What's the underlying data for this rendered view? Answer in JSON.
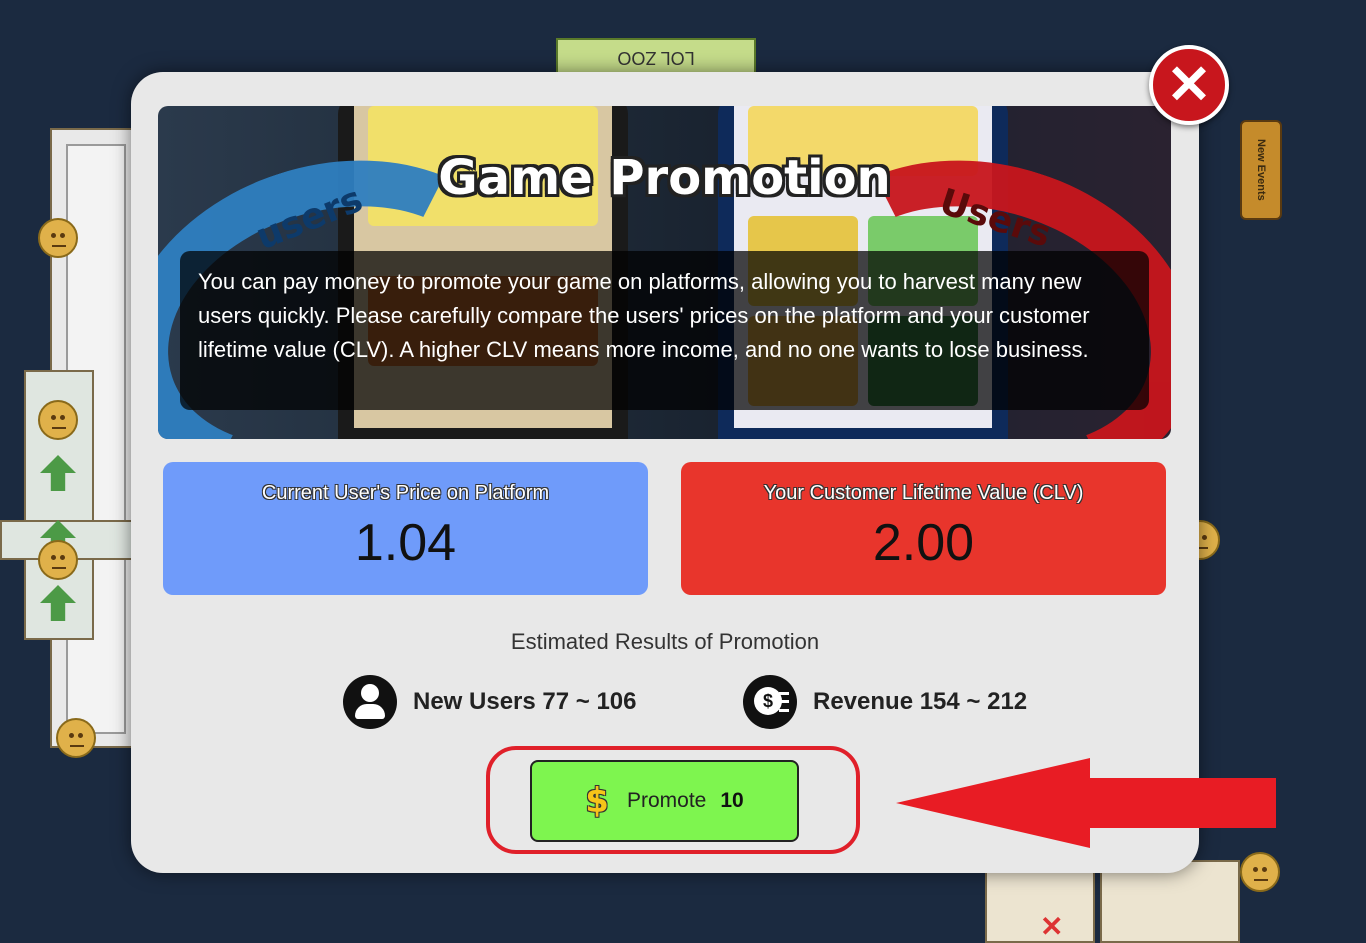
{
  "background": {
    "sign_text": "New Events",
    "top_sign_text": "LOL ZOO"
  },
  "modal": {
    "close_label": "✕",
    "banner": {
      "title": "Game Promotion",
      "swoosh_left": "users",
      "swoosh_right": "Users",
      "description": "You can pay money to promote your game on platforms, allowing you to harvest many new users quickly. Please carefully compare the users' prices on the platform and your customer lifetime value (CLV). A higher CLV means more income, and no one wants to lose business."
    },
    "price_card": {
      "label": "Current User's Price on Platform",
      "value": "1.04",
      "color": "#6f9bfa"
    },
    "clv_card": {
      "label": "Your Customer Lifetime Value (CLV)",
      "value": "2.00",
      "color": "#e8352c"
    },
    "estimates": {
      "title": "Estimated Results of Promotion",
      "users_text": "New Users 77 ~ 106",
      "revenue_text": "Revenue 154 ~ 212"
    },
    "promote_button": {
      "icon": "dollar-icon",
      "label": "Promote",
      "cost": "10",
      "color": "#7ef54f"
    }
  },
  "annotation": {
    "ring_color": "#e0202a",
    "arrow_color": "#e81c24"
  }
}
